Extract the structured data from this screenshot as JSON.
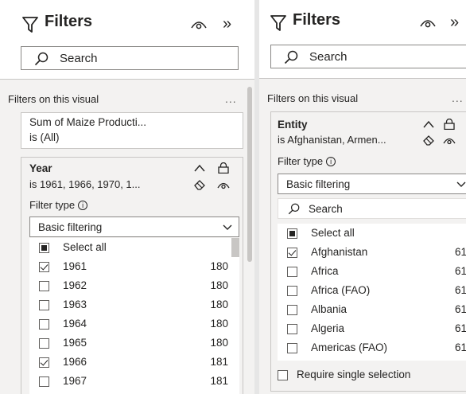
{
  "left_pane": {
    "title": "Filters",
    "search_placeholder": "Search",
    "section_label": "Filters on this visual",
    "more_label": "...",
    "collapsed_card": {
      "field": "Sum of Maize Producti...",
      "condition": "is (All)"
    },
    "year_card": {
      "field": "Year",
      "summary": "is 1961, 1966, 1970, 1...",
      "filter_type_label": "Filter type",
      "filter_type_value": "Basic filtering",
      "items": [
        {
          "label": "Select all",
          "count": "",
          "state": "partial"
        },
        {
          "label": "1961",
          "count": "180",
          "state": "checked"
        },
        {
          "label": "1962",
          "count": "180",
          "state": "unchecked"
        },
        {
          "label": "1963",
          "count": "180",
          "state": "unchecked"
        },
        {
          "label": "1964",
          "count": "180",
          "state": "unchecked"
        },
        {
          "label": "1965",
          "count": "180",
          "state": "unchecked"
        },
        {
          "label": "1966",
          "count": "181",
          "state": "checked"
        },
        {
          "label": "1967",
          "count": "181",
          "state": "unchecked"
        }
      ]
    }
  },
  "right_pane": {
    "title": "Filters",
    "search_placeholder": "Search",
    "section_label": "Filters on this visual",
    "more_label": "...",
    "entity_card": {
      "field": "Entity",
      "summary": "is Afghanistan, Armen...",
      "filter_type_label": "Filter type",
      "filter_type_value": "Basic filtering",
      "search_placeholder": "Search",
      "items": [
        {
          "label": "Select all",
          "count": "",
          "state": "partial"
        },
        {
          "label": "Afghanistan",
          "count": "61",
          "state": "checked"
        },
        {
          "label": "Africa",
          "count": "61",
          "state": "unchecked"
        },
        {
          "label": "Africa (FAO)",
          "count": "61",
          "state": "unchecked"
        },
        {
          "label": "Albania",
          "count": "61",
          "state": "unchecked"
        },
        {
          "label": "Algeria",
          "count": "61",
          "state": "unchecked"
        },
        {
          "label": "Americas (FAO)",
          "count": "61",
          "state": "unchecked"
        }
      ],
      "require_single_label": "Require single selection"
    }
  },
  "icons": {
    "filter": "filter-funnel-icon",
    "eye": "eye-visibility-icon",
    "collapse": "double-chevron-right-icon",
    "search": "search-icon",
    "expand": "chevron-up-icon",
    "lock": "lock-icon",
    "eraser": "eraser-icon",
    "info": "info-icon",
    "dropdown": "chevron-down-icon"
  },
  "colors": {
    "pane_background": "#ffffff",
    "filter_area_background": "#f3f2f1",
    "border": "#c8c6c4",
    "text": "#252423"
  }
}
